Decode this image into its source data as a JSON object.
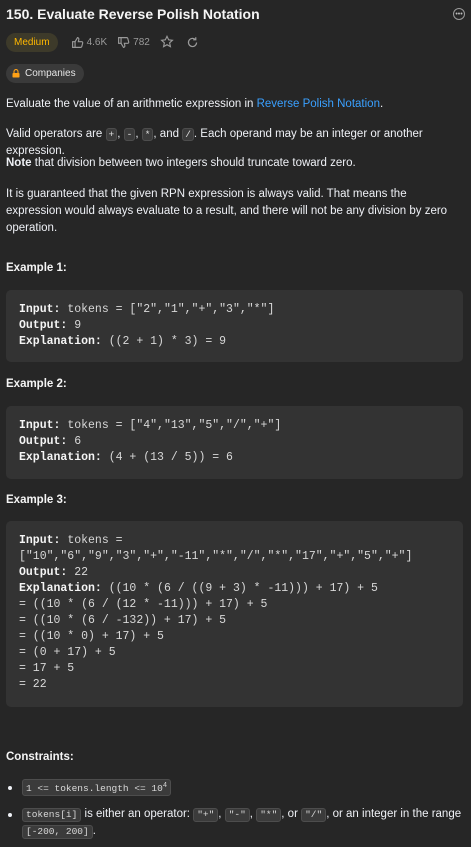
{
  "problem": {
    "title": "150. Evaluate Reverse Polish Notation",
    "difficulty": "Medium",
    "likes": "4.6K",
    "dislikes": "782",
    "companies_label": "Companies"
  },
  "description": {
    "p1_pre": "Evaluate the value of an arithmetic expression in ",
    "p1_link": "Reverse Polish Notation",
    "p1_post": ".",
    "p2_pre": "Valid operators are ",
    "op_plus": "+",
    "op_minus": "-",
    "op_mul": "*",
    "op_div": "/",
    "p2_sep1": ", ",
    "p2_sep2": ", ",
    "p2_and": ", and ",
    "p2_post": ". Each operand may be an integer or another expression.",
    "p3_bold": "Note",
    "p3_rest": " that division between two integers should truncate toward zero.",
    "p4": "It is guaranteed that the given RPN expression is always valid. That means the expression would always evaluate to a result, and there will not be any division by zero operation."
  },
  "examples": [
    {
      "heading": "Example 1:",
      "input_label": "Input:",
      "input": " tokens = [\"2\",\"1\",\"+\",\"3\",\"*\"]",
      "output_label": "Output:",
      "output": " 9",
      "expl_label": "Explanation:",
      "expl": " ((2 + 1) * 3) = 9"
    },
    {
      "heading": "Example 2:",
      "input_label": "Input:",
      "input": " tokens = [\"4\",\"13\",\"5\",\"/\",\"+\"]",
      "output_label": "Output:",
      "output": " 6",
      "expl_label": "Explanation:",
      "expl": " (4 + (13 / 5)) = 6"
    },
    {
      "heading": "Example 3:",
      "input_label": "Input:",
      "input": " tokens =\n[\"10\",\"6\",\"9\",\"3\",\"+\",\"-11\",\"*\",\"/\",\"*\",\"17\",\"+\",\"5\",\"+\"]",
      "output_label": "Output:",
      "output": " 22",
      "expl_label": "Explanation:",
      "expl": " ((10 * (6 / ((9 + 3) * -11))) + 17) + 5\n= ((10 * (6 / (12 * -11))) + 17) + 5\n= ((10 * (6 / -132)) + 17) + 5\n= ((10 * 0) + 17) + 5\n= (0 + 17) + 5\n= 17 + 5\n= 22"
    }
  ],
  "constraints": {
    "heading": "Constraints:",
    "c1_code": "1 <= tokens.length <= 10",
    "c1_sup": "4",
    "c2_code": "tokens[i]",
    "c2_text1": " is either an operator: ",
    "c2_op1": "\"+\"",
    "c2_op2": "\"-\"",
    "c2_op3": "\"*\"",
    "c2_op4": "\"/\"",
    "c2_sep": ", ",
    "c2_or": ", or ",
    "c2_text2": ", or an integer in the range ",
    "c2_range": "[-200, 200]",
    "c2_end": "."
  },
  "colors": {
    "background": "#262626",
    "medium_badge_text": "#ffb800",
    "link": "#3aa0ff",
    "example_box": "#333333"
  },
  "icons": [
    "more-options-icon",
    "thumbs-up-icon",
    "thumbs-down-icon",
    "star-icon",
    "share-icon",
    "lock-icon"
  ]
}
